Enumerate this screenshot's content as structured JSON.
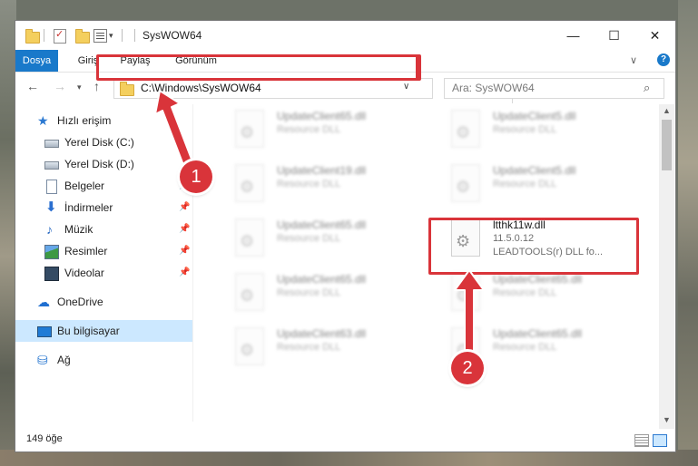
{
  "window": {
    "title": "SysWOW64",
    "controls": {
      "minimize": "—",
      "maximize": "☐",
      "close": "✕"
    }
  },
  "ribbon": {
    "tabs": [
      "Dosya",
      "Giriş",
      "Paylaş",
      "Görünüm"
    ],
    "help": "?"
  },
  "navigation": {
    "address": "C:\\Windows\\SysWOW64",
    "search_placeholder": "Ara: SysWOW64"
  },
  "sidebar": {
    "items": [
      {
        "label": "Hızlı erişim",
        "icon": "star-icon"
      },
      {
        "label": "Yerel Disk (C:)",
        "icon": "drive-icon"
      },
      {
        "label": "Yerel Disk (D:)",
        "icon": "drive-icon"
      },
      {
        "label": "Belgeler",
        "icon": "document-icon"
      },
      {
        "label": "İndirmeler",
        "icon": "download-icon"
      },
      {
        "label": "Müzik",
        "icon": "music-icon"
      },
      {
        "label": "Resimler",
        "icon": "pictures-icon"
      },
      {
        "label": "Videolar",
        "icon": "video-icon"
      },
      {
        "label": "OneDrive",
        "icon": "cloud-icon"
      },
      {
        "label": "Bu bilgisayar",
        "icon": "computer-icon"
      },
      {
        "label": "Ağ",
        "icon": "network-icon"
      }
    ],
    "selected": "Bu bilgisayar"
  },
  "files": {
    "items": [
      {
        "name": "UpdateClient65.dll",
        "type": "Resource DLL"
      },
      {
        "name": "UpdateClient5.dll",
        "type": "Resource DLL"
      },
      {
        "name": "UpdateClient19.dll",
        "type": "Resource DLL"
      },
      {
        "name": "UpdateClient5.dll",
        "type": "Resource DLL"
      },
      {
        "name": "UpdateClient65.dll",
        "type": "Resource DLL"
      },
      {
        "name": "ltthk11w.dll",
        "version": "11.5.0.12",
        "description": "LEADTOOLS(r) DLL fo..."
      },
      {
        "name": "UpdateClient65.dll",
        "type": "Resource DLL"
      },
      {
        "name": "UpdateClient65.dll",
        "type": "Resource DLL"
      },
      {
        "name": "UpdateClient63.dll",
        "type": "Resource DLL"
      },
      {
        "name": "UpdateClient65.dll",
        "type": "Resource DLL"
      }
    ]
  },
  "status": {
    "item_count": "149 öğe"
  },
  "annotations": {
    "step1": "1",
    "step2": "2",
    "color": "#d9343a"
  }
}
